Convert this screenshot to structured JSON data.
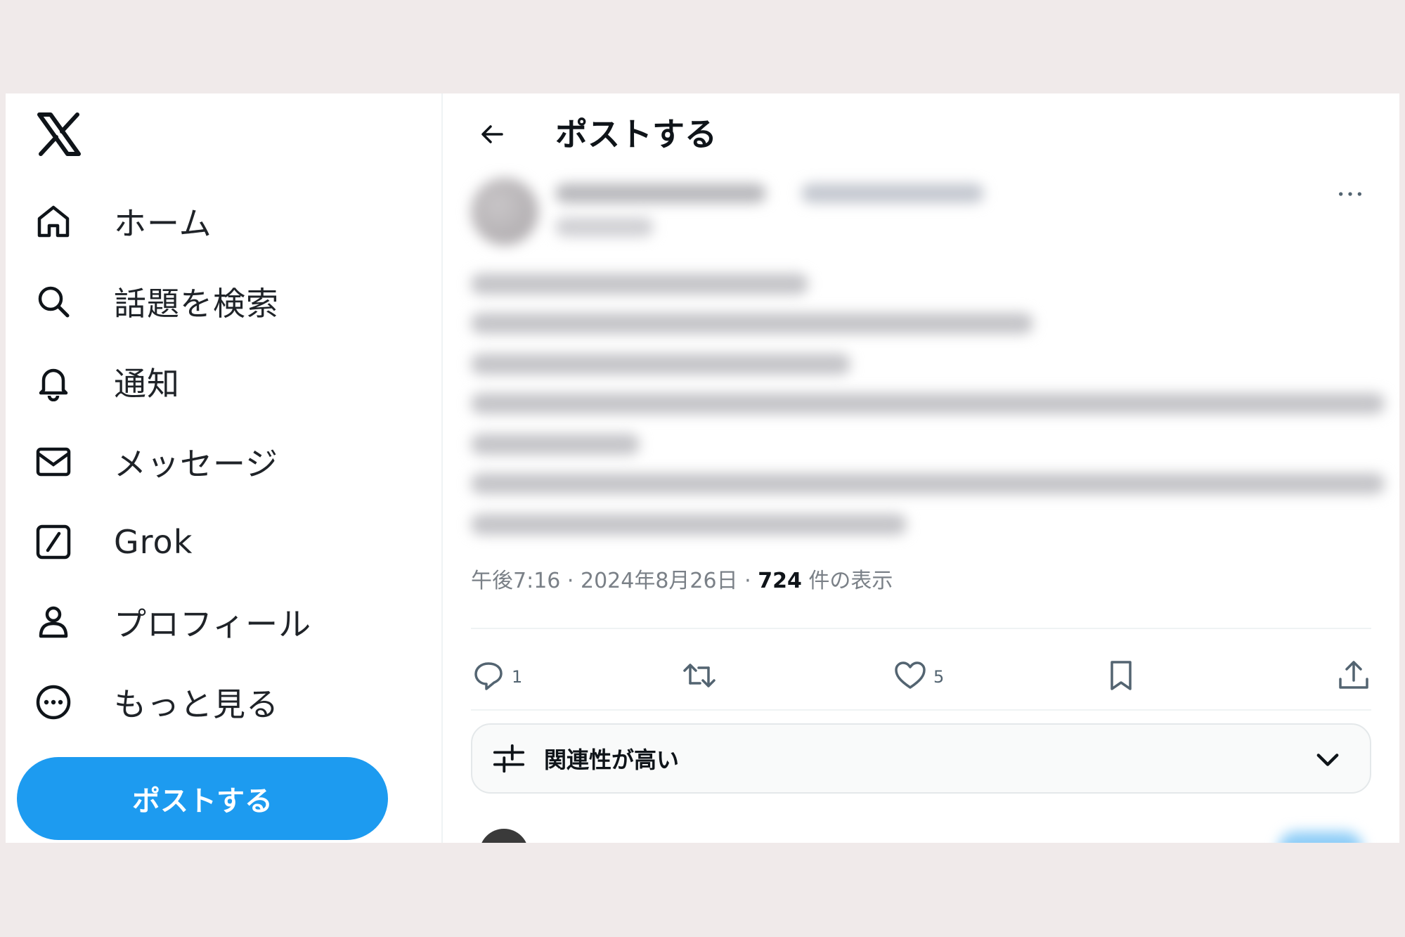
{
  "sidebar": {
    "logo": "x-logo-icon",
    "items": [
      {
        "label": "ホーム",
        "icon": "home-icon"
      },
      {
        "label": "話題を検索",
        "icon": "search-icon"
      },
      {
        "label": "通知",
        "icon": "bell-icon"
      },
      {
        "label": "メッセージ",
        "icon": "mail-icon"
      },
      {
        "label": "Grok",
        "icon": "grok-icon"
      },
      {
        "label": "プロフィール",
        "icon": "person-icon"
      },
      {
        "label": "もっと見る",
        "icon": "more-circle-icon"
      }
    ],
    "post_button": "ポストする"
  },
  "header": {
    "title": "ポストする",
    "back_icon": "back-arrow-icon"
  },
  "post": {
    "time": "午後7:16 · 2024年8月26日 · ",
    "views_count": "724",
    "views_label": " 件の表示",
    "actions": {
      "reply_count": "1",
      "retweet_count": "",
      "like_count": "5"
    }
  },
  "sort": {
    "label": "関連性が高い"
  },
  "colors": {
    "accent": "#1d9bf0",
    "background": "#f0eaea",
    "secondary_text": "#536471"
  }
}
